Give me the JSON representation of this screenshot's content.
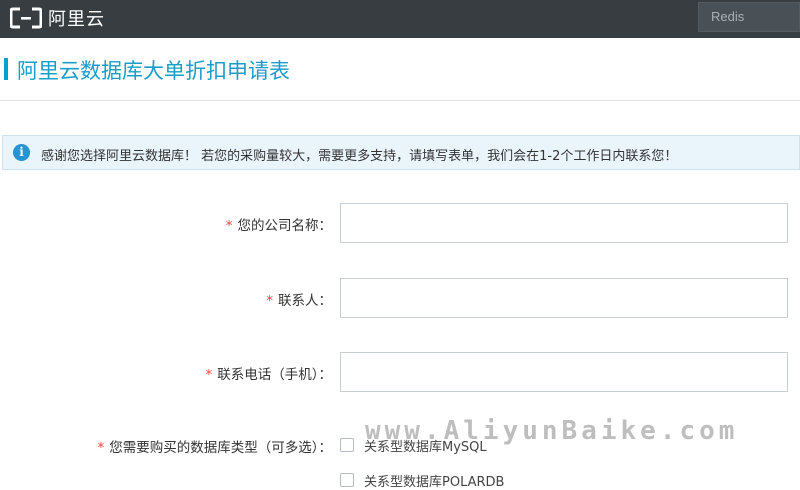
{
  "topbar": {
    "logo_text": "阿里云",
    "search_value": "Redis"
  },
  "page_title": "阿里云数据库大单折扣申请表",
  "notice": {
    "icon": "info-icon",
    "text": "感谢您选择阿里云数据库！ 若您的采购量较大，需要更多支持，请填写表单，我们会在1-2个工作日内联系您！"
  },
  "form": {
    "required_mark": "*",
    "company": {
      "label": "您的公司名称：",
      "value": ""
    },
    "contact": {
      "label": "联系人：",
      "value": ""
    },
    "phone": {
      "label": "联系电话（手机）：",
      "value": ""
    },
    "db_type": {
      "label": "您需要购买的数据库类型（可多选）：",
      "options": [
        {
          "label": "关系型数据库MySQL",
          "checked": false
        },
        {
          "label": "关系型数据库POLARDB",
          "checked": false
        }
      ]
    }
  },
  "watermark": "www.AliyunBaike.com",
  "colors": {
    "topbar_bg": "#373d41",
    "accent": "#00a2ca",
    "title_color": "#1a9ec9",
    "required": "#f04134",
    "notice_bg": "#eaf4fb"
  }
}
